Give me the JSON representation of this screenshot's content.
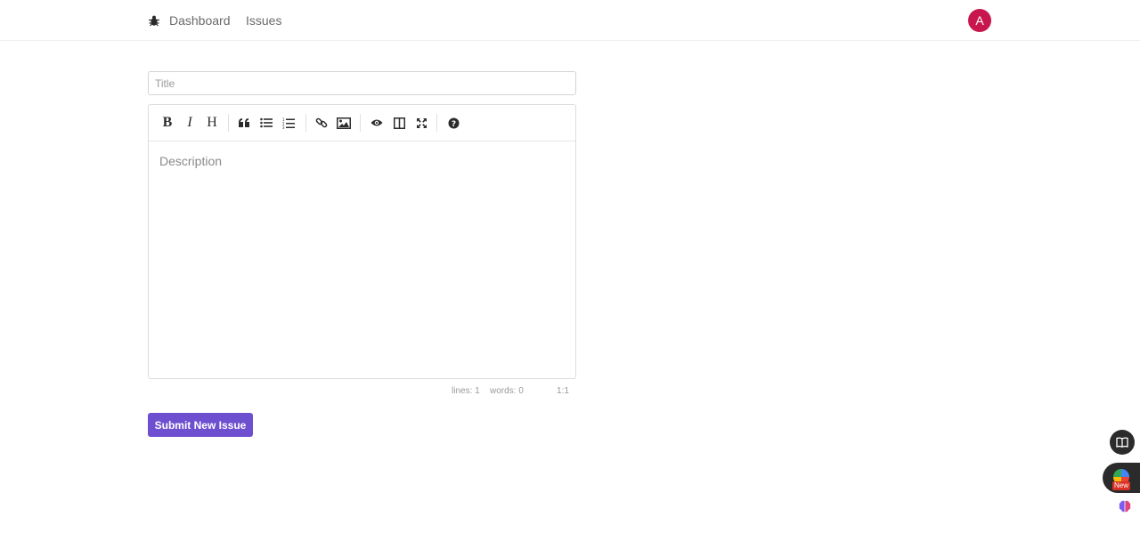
{
  "nav": {
    "logo_icon": "bug-icon",
    "links": [
      {
        "label": "Dashboard"
      },
      {
        "label": "Issues"
      }
    ],
    "avatar_initial": "A",
    "avatar_color": "#c8174f"
  },
  "form": {
    "title_placeholder": "Title",
    "title_value": "",
    "description_placeholder": "Description",
    "toolbar": [
      {
        "icon": "bold-icon",
        "glyph": "B"
      },
      {
        "icon": "italic-icon",
        "glyph": "I"
      },
      {
        "icon": "heading-icon",
        "glyph": "H"
      },
      {
        "icon": "quote-icon"
      },
      {
        "icon": "unordered-list-icon"
      },
      {
        "icon": "ordered-list-icon"
      },
      {
        "icon": "link-icon"
      },
      {
        "icon": "image-icon"
      },
      {
        "icon": "preview-eye-icon"
      },
      {
        "icon": "side-by-side-icon"
      },
      {
        "icon": "fullscreen-icon"
      },
      {
        "icon": "help-icon"
      }
    ],
    "status": {
      "lines": "lines: 1",
      "words": "words: 0",
      "cursor": "1:1"
    },
    "submit_label": "Submit New Issue",
    "accent_color": "#6e4fd0"
  },
  "floating": {
    "new_badge": "New",
    "icons": [
      "book-icon",
      "chrome-extension-icon",
      "brain-icon"
    ]
  }
}
